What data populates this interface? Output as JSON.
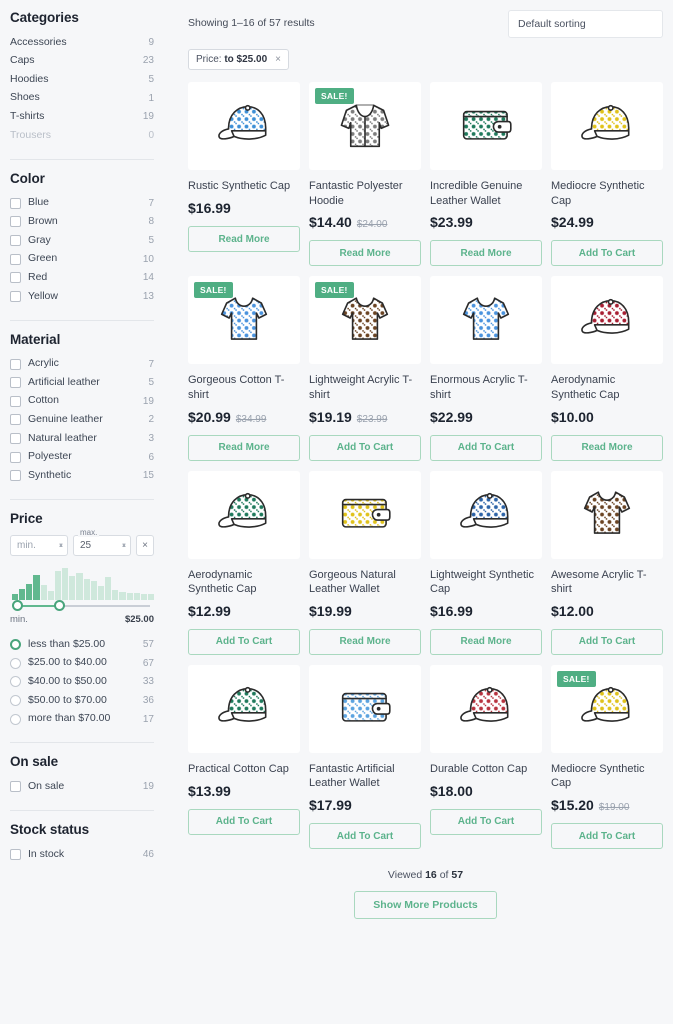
{
  "sidebar": {
    "categories": {
      "title": "Categories",
      "items": [
        {
          "label": "Accessories",
          "count": "9",
          "disabled": false
        },
        {
          "label": "Caps",
          "count": "23",
          "disabled": false
        },
        {
          "label": "Hoodies",
          "count": "5",
          "disabled": false
        },
        {
          "label": "Shoes",
          "count": "1",
          "disabled": false
        },
        {
          "label": "T-shirts",
          "count": "19",
          "disabled": false
        },
        {
          "label": "Trousers",
          "count": "0",
          "disabled": true
        }
      ]
    },
    "color": {
      "title": "Color",
      "items": [
        {
          "label": "Blue",
          "count": "7"
        },
        {
          "label": "Brown",
          "count": "8"
        },
        {
          "label": "Gray",
          "count": "5"
        },
        {
          "label": "Green",
          "count": "10"
        },
        {
          "label": "Red",
          "count": "14"
        },
        {
          "label": "Yellow",
          "count": "13"
        }
      ]
    },
    "material": {
      "title": "Material",
      "items": [
        {
          "label": "Acrylic",
          "count": "7"
        },
        {
          "label": "Artificial leather",
          "count": "5"
        },
        {
          "label": "Cotton",
          "count": "19"
        },
        {
          "label": "Genuine leather",
          "count": "2"
        },
        {
          "label": "Natural leather",
          "count": "3"
        },
        {
          "label": "Polyester",
          "count": "6"
        },
        {
          "label": "Synthetic",
          "count": "15"
        }
      ]
    },
    "price": {
      "title": "Price",
      "min_placeholder": "min.",
      "min_value": "",
      "max_label": "max.",
      "max_value": "25",
      "clear_icon": "×",
      "slider_min_label": "min.",
      "slider_max_label": "$25.00",
      "histogram": [
        18,
        34,
        52,
        80,
        46,
        30,
        92,
        100,
        76,
        84,
        66,
        60,
        44,
        72,
        32,
        26,
        22,
        24,
        20,
        18
      ],
      "histogram_selected": 4,
      "ranges": [
        {
          "label": "less than $25.00",
          "count": "57",
          "selected": true
        },
        {
          "label": "$25.00 to $40.00",
          "count": "67",
          "selected": false
        },
        {
          "label": "$40.00 to $50.00",
          "count": "33",
          "selected": false
        },
        {
          "label": "$50.00 to $70.00",
          "count": "36",
          "selected": false
        },
        {
          "label": "more than $70.00",
          "count": "17",
          "selected": false
        }
      ]
    },
    "on_sale": {
      "title": "On sale",
      "items": [
        {
          "label": "On sale",
          "count": "19"
        }
      ]
    },
    "stock_status": {
      "title": "Stock status",
      "items": [
        {
          "label": "In stock",
          "count": "46"
        }
      ]
    }
  },
  "main": {
    "showing": "Showing 1–16 of 57 results",
    "sorting": "Default sorting",
    "chip": {
      "prefix": "Price: ",
      "value": "to $25.00",
      "remove_icon": "×"
    },
    "footer": {
      "viewed_prefix": "Viewed ",
      "viewed_count": "16",
      "viewed_mid": " of ",
      "viewed_total": "57",
      "show_more": "Show More Products"
    },
    "products": [
      {
        "name": "Rustic Synthetic Cap",
        "price": "$16.99",
        "old_price": "",
        "sale": false,
        "button": "Read More",
        "icon": "cap",
        "color": "#3d8fd6"
      },
      {
        "name": "Fantastic Polyester Hoodie",
        "price": "$14.40",
        "old_price": "$24.00",
        "sale": true,
        "button": "Read More",
        "icon": "hoodie",
        "color": "#7d7d7d"
      },
      {
        "name": "Incredible Genuine Leather Wallet",
        "price": "$23.99",
        "old_price": "",
        "sale": false,
        "button": "Read More",
        "icon": "wallet",
        "color": "#1f7a5c"
      },
      {
        "name": "Mediocre Synthetic Cap",
        "price": "$24.99",
        "old_price": "",
        "sale": false,
        "button": "Add To Cart",
        "icon": "cap",
        "color": "#e0c21a"
      },
      {
        "name": "Gorgeous Cotton T-shirt",
        "price": "$20.99",
        "old_price": "$34.99",
        "sale": true,
        "button": "Read More",
        "icon": "tshirt",
        "color": "#4a93de"
      },
      {
        "name": "Lightweight Acrylic T-shirt",
        "price": "$19.19",
        "old_price": "$23.99",
        "sale": true,
        "button": "Add To Cart",
        "icon": "tshirt",
        "color": "#6b4423"
      },
      {
        "name": "Enormous Acrylic T-shirt",
        "price": "$22.99",
        "old_price": "",
        "sale": false,
        "button": "Add To Cart",
        "icon": "tshirt",
        "color": "#4a93de"
      },
      {
        "name": "Aerodynamic Synthetic Cap",
        "price": "$10.00",
        "old_price": "",
        "sale": false,
        "button": "Read More",
        "icon": "cap",
        "color": "#a81f33"
      },
      {
        "name": "Aerodynamic Synthetic Cap",
        "price": "$12.99",
        "old_price": "",
        "sale": false,
        "button": "Add To Cart",
        "icon": "cap",
        "color": "#1f7a5c"
      },
      {
        "name": "Gorgeous Natural Leather Wallet",
        "price": "$19.99",
        "old_price": "",
        "sale": false,
        "button": "Read More",
        "icon": "wallet",
        "color": "#e0c21a"
      },
      {
        "name": "Lightweight Synthetic Cap",
        "price": "$16.99",
        "old_price": "",
        "sale": false,
        "button": "Read More",
        "icon": "cap",
        "color": "#2d64a8"
      },
      {
        "name": "Awesome Acrylic T-shirt",
        "price": "$12.00",
        "old_price": "",
        "sale": false,
        "button": "Add To Cart",
        "icon": "tshirt",
        "color": "#6b4423"
      },
      {
        "name": "Practical Cotton Cap",
        "price": "$13.99",
        "old_price": "",
        "sale": false,
        "button": "Add To Cart",
        "icon": "cap",
        "color": "#1f7a5c"
      },
      {
        "name": "Fantastic Artificial Leather Wallet",
        "price": "$17.99",
        "old_price": "",
        "sale": false,
        "button": "Add To Cart",
        "icon": "wallet",
        "color": "#5ba3e0"
      },
      {
        "name": "Durable Cotton Cap",
        "price": "$18.00",
        "old_price": "",
        "sale": false,
        "button": "Add To Cart",
        "icon": "cap",
        "color": "#b8333f"
      },
      {
        "name": "Mediocre Synthetic Cap",
        "price": "$15.20",
        "old_price": "$19.00",
        "sale": true,
        "button": "Add To Cart",
        "icon": "cap",
        "color": "#e0c21a"
      }
    ],
    "sale_badge": "SALE!"
  }
}
